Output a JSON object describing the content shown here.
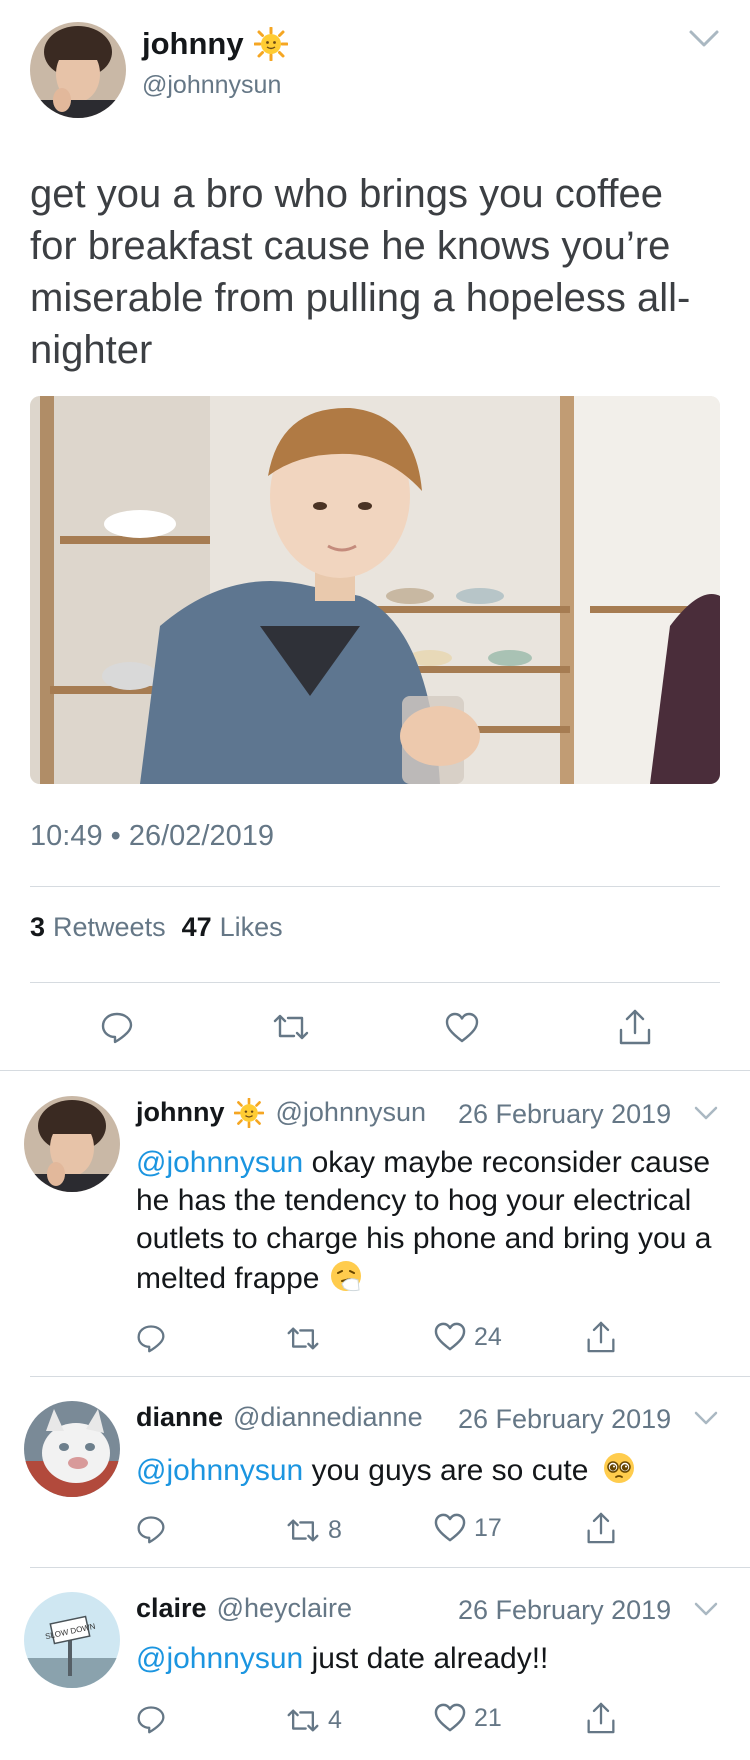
{
  "main_tweet": {
    "author_name": "johnny",
    "author_emoji": "sun-with-face",
    "author_handle": "@johnnysun",
    "text": "get you a bro who brings you coffee for breakfast cause he knows you’re miserable from pulling a hopeless all-nighter",
    "timestamp": "10:49 • 26/02/2019",
    "retweets_count": "3",
    "retweets_label": "Retweets",
    "likes_count": "47",
    "likes_label": "Likes"
  },
  "replies": [
    {
      "author_name": "johnny",
      "author_emoji": "sun-with-face",
      "author_handle": "@johnnysun",
      "date": "26 February 2019",
      "mention": "@johnnysun",
      "text": "okay maybe reconsider cause he has the tendency to hog your electrical outlets to charge his phone and bring you a melted frappe",
      "text_emoji": "sneezing-face",
      "retweets": "",
      "likes": "24"
    },
    {
      "author_name": "dianne",
      "author_handle": "@diannedianne",
      "date": "26 February 2019",
      "mention": "@johnnysun",
      "text": "you guys are so cute",
      "text_emoji": "pleading-face",
      "retweets": "8",
      "likes": "17"
    },
    {
      "author_name": "claire",
      "author_handle": "@heyclaire",
      "date": "26 February 2019",
      "mention": "@johnnysun",
      "text": "just date already!!",
      "retweets": "4",
      "likes": "21",
      "avatar_sign_text": "SLOW DOWN"
    }
  ],
  "colors": {
    "link": "#1b95e0",
    "muted": "#657786",
    "text": "#14171a",
    "divider": "#d6dbe0"
  }
}
